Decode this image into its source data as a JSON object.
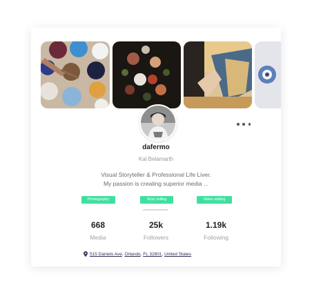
{
  "profile": {
    "username": "dafermo",
    "real_name": "Kal Belamarth",
    "bio_line1": "Visual Storyteller & Professional Life Liver.",
    "bio_line2": "My passion is creating superior media ..."
  },
  "tags": [
    "Photography",
    "Story telling",
    "Video editing"
  ],
  "stats": [
    {
      "value": "668",
      "label": "Media"
    },
    {
      "value": "25k",
      "label": "Followers"
    },
    {
      "value": "1.19k",
      "label": "Following"
    }
  ],
  "location": {
    "street": "515 Daniels Ave",
    "city": "Orlando",
    "region": "FL 32801",
    "country": "United States"
  },
  "icons": {
    "more": "more-horizontal-icon",
    "location": "map-pin-icon"
  },
  "colors": {
    "tag": "#3ee0a0",
    "card_bg": "#ffffff",
    "text_primary": "#222222",
    "text_muted": "#a0a0a0"
  }
}
